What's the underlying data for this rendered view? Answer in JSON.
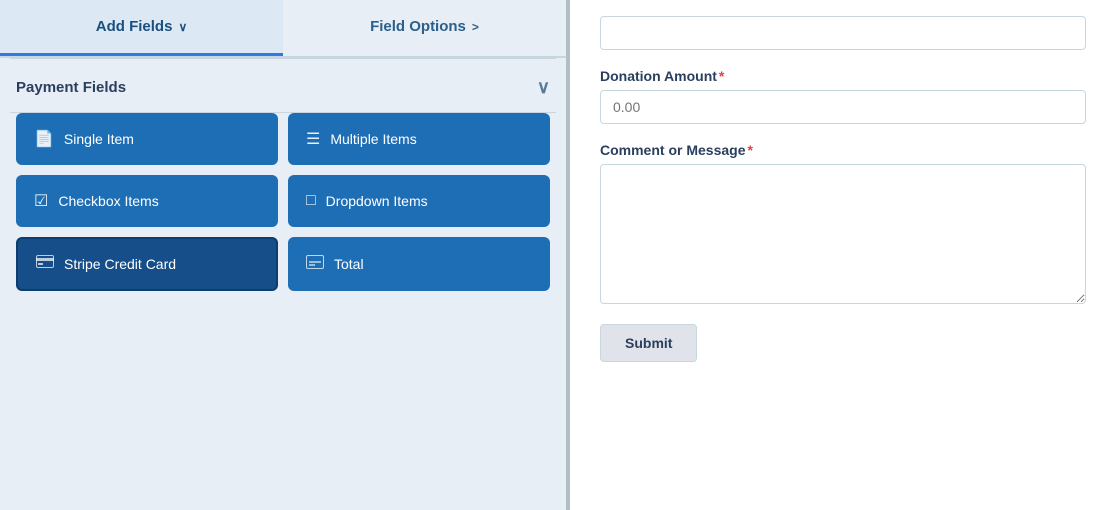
{
  "tabs": {
    "add_fields_label": "Add Fields",
    "add_fields_chevron": "∨",
    "field_options_label": "Field Options",
    "field_options_chevron": ">"
  },
  "payment_section": {
    "header": "Payment Fields",
    "chevron": "∨"
  },
  "buttons": [
    {
      "id": "single-item",
      "label": "Single Item",
      "icon": "📄"
    },
    {
      "id": "multiple-items",
      "label": "Multiple Items",
      "icon": "≡"
    },
    {
      "id": "checkbox-items",
      "label": "Checkbox Items",
      "icon": "☑"
    },
    {
      "id": "dropdown-items",
      "label": "Dropdown Items",
      "icon": "⊡"
    },
    {
      "id": "stripe-credit-card",
      "label": "Stripe Credit Card",
      "icon": "💳",
      "active": true
    },
    {
      "id": "total",
      "label": "Total",
      "icon": "⊟"
    }
  ],
  "form": {
    "top_input_placeholder": "",
    "donation_label": "Donation Amount",
    "donation_placeholder": "0.00",
    "comment_label": "Comment or Message",
    "comment_placeholder": "",
    "submit_label": "Submit"
  }
}
